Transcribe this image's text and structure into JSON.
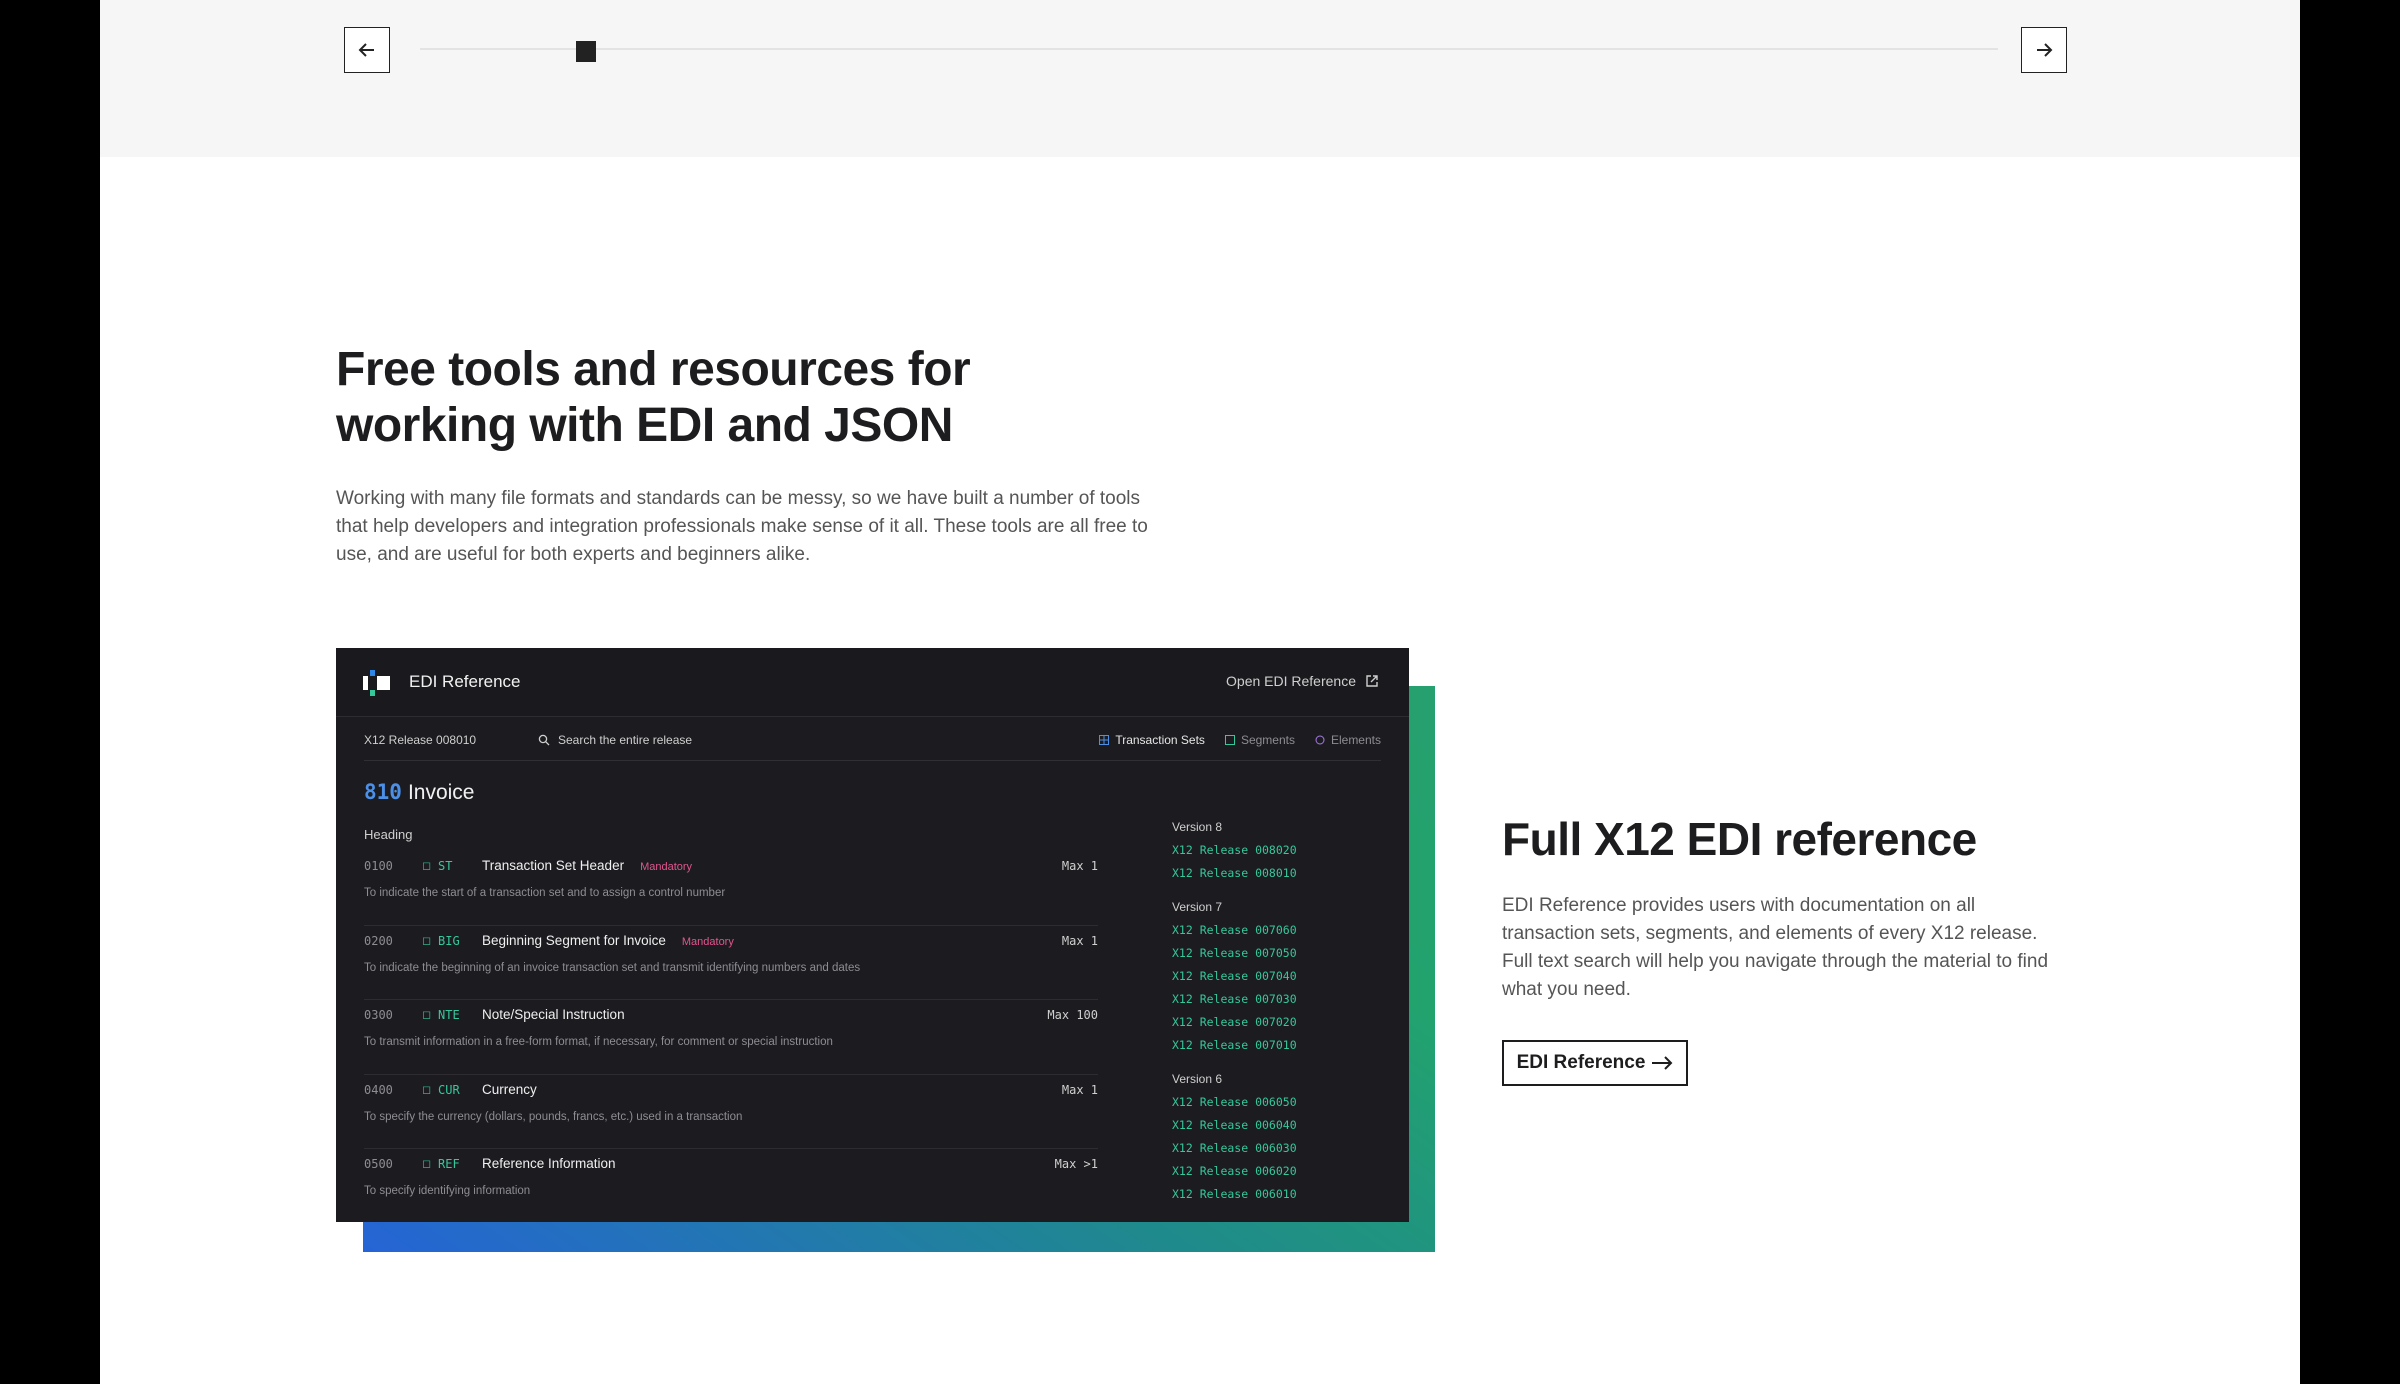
{
  "carousel": {
    "prev_icon": "arrow-left-icon",
    "next_icon": "arrow-right-icon",
    "position": 0.1
  },
  "hero": {
    "title_line1": "Free tools and resources for",
    "title_line2": "working with EDI and JSON",
    "description": "Working with many file formats and standards can be messy, so we have built a number of tools that help developers and integration professionals make sense of it all. These tools are all free to use, and are useful for both experts and beginners alike."
  },
  "app": {
    "title": "EDI Reference",
    "open_link": "Open EDI Reference",
    "release": "X12 Release 008010",
    "search_placeholder": "Search the entire release",
    "filters": [
      "Transaction Sets",
      "Segments",
      "Elements"
    ],
    "doc_code": "810",
    "doc_name": "Invoice",
    "section": "Heading",
    "segments": [
      {
        "pos": "0100",
        "code": "ST",
        "name": "Transaction Set Header",
        "tag": "Mandatory",
        "max": "Max 1",
        "desc": "To indicate the start of a transaction set and to assign a control number"
      },
      {
        "pos": "0200",
        "code": "BIG",
        "name": "Beginning Segment for Invoice",
        "tag": "Mandatory",
        "max": "Max 1",
        "desc": "To indicate the beginning of an invoice transaction set and transmit identifying numbers and dates"
      },
      {
        "pos": "0300",
        "code": "NTE",
        "name": "Note/Special Instruction",
        "tag": "",
        "max": "Max 100",
        "desc": "To transmit information in a free-form format, if necessary, for comment or special instruction"
      },
      {
        "pos": "0400",
        "code": "CUR",
        "name": "Currency",
        "tag": "",
        "max": "Max 1",
        "desc": "To specify the currency (dollars, pounds, francs, etc.) used in a transaction"
      },
      {
        "pos": "0500",
        "code": "REF",
        "name": "Reference Information",
        "tag": "",
        "max": "Max >1",
        "desc": "To specify identifying information"
      }
    ],
    "versions": [
      {
        "label": "Version 8",
        "releases": [
          "X12 Release 008020",
          "X12 Release 008010"
        ]
      },
      {
        "label": "Version 7",
        "releases": [
          "X12 Release 007060",
          "X12 Release 007050",
          "X12 Release 007040",
          "X12 Release 007030",
          "X12 Release 007020",
          "X12 Release 007010"
        ]
      },
      {
        "label": "Version 6",
        "releases": [
          "X12 Release 006050",
          "X12 Release 006040",
          "X12 Release 006030",
          "X12 Release 006020",
          "X12 Release 006010"
        ]
      }
    ]
  },
  "feature": {
    "title": "Full X12 EDI reference",
    "description": "EDI Reference provides users with documentation on all transaction sets, segments, and elements of every X12 release. Full text search will help you navigate through the material to find what you need.",
    "cta_label": "EDI Reference"
  }
}
